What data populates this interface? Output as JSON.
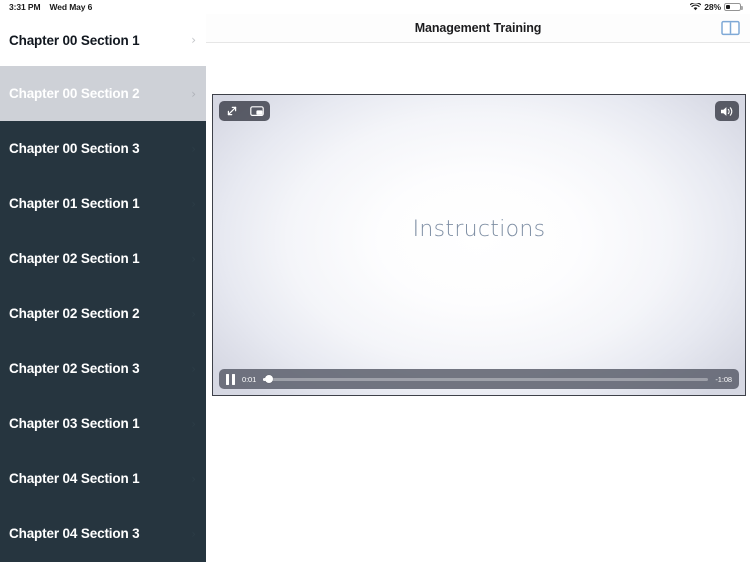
{
  "status_bar": {
    "time": "3:31 PM",
    "date": "Wed May 6",
    "battery_percent": "28%",
    "wifi_icon": "wifi-icon",
    "battery_icon": "battery-icon",
    "battery_level": 28
  },
  "navbar": {
    "title": "Management Training",
    "book_icon": "book-icon"
  },
  "sidebar": {
    "items": [
      {
        "label": "Chapter 00 Section 1",
        "state": "plain",
        "chevron": "›"
      },
      {
        "label": "Chapter 00 Section 2",
        "state": "selected",
        "chevron": "›"
      },
      {
        "label": "Chapter 00 Section 3",
        "state": "dark",
        "chevron": "›"
      },
      {
        "label": "Chapter 01 Section 1",
        "state": "dark",
        "chevron": "›"
      },
      {
        "label": "Chapter 02 Section 1",
        "state": "dark",
        "chevron": "›"
      },
      {
        "label": "Chapter 02 Section 2",
        "state": "dark",
        "chevron": "›"
      },
      {
        "label": "Chapter 02 Section 3",
        "state": "dark",
        "chevron": "›"
      },
      {
        "label": "Chapter 03 Section 1",
        "state": "dark",
        "chevron": "›"
      },
      {
        "label": "Chapter 04 Section 1",
        "state": "dark",
        "chevron": "›"
      },
      {
        "label": "Chapter 04 Section 3",
        "state": "dark",
        "chevron": "›"
      }
    ]
  },
  "video": {
    "title_overlay": "Instructions",
    "fullscreen_icon": "expand-icon",
    "pip_icon": "picture-in-picture-icon",
    "volume_icon": "volume-icon",
    "play_state_icon": "pause-icon",
    "time_elapsed": "0:01",
    "time_remaining": "-1:08",
    "progress_percent": 1.4
  },
  "colors": {
    "sidebar_dark": "#26353f",
    "sidebar_selected": "#ced1d7",
    "accent_book_icon": "#7fa9d6",
    "video_title": "#7f8fa4"
  }
}
